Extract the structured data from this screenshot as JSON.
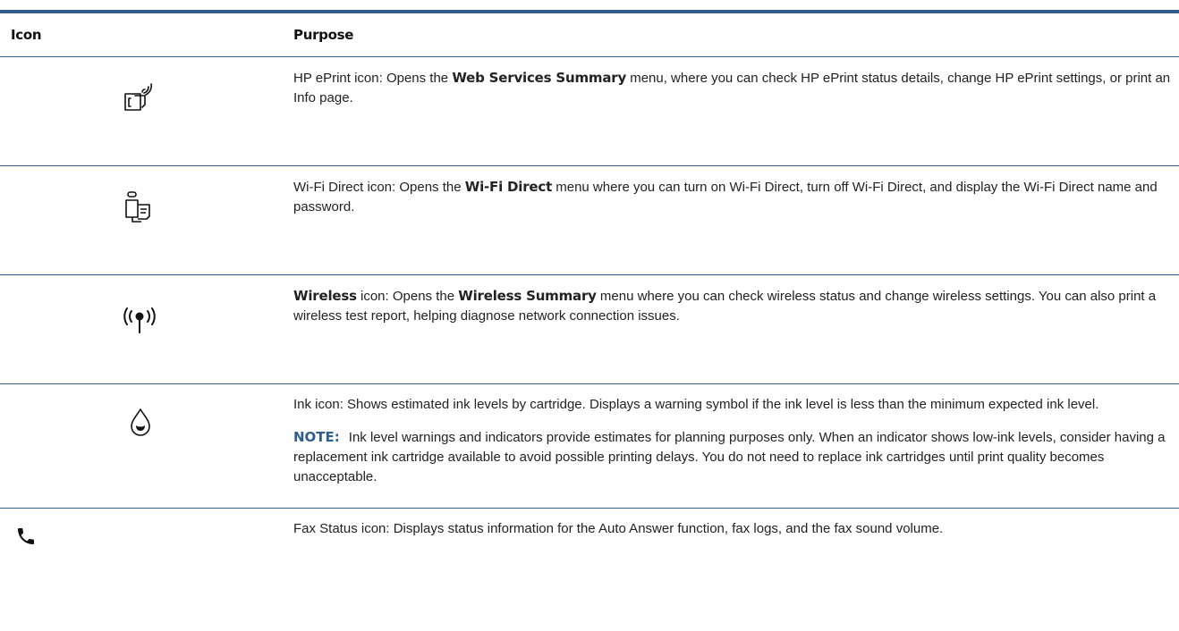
{
  "table": {
    "headers": {
      "icon": "Icon",
      "purpose": "Purpose"
    },
    "rows": [
      {
        "icon": "eprint-icon",
        "pre": "HP ePrint icon: Opens the ",
        "bold": "Web Services Summary",
        "post": " menu, where you can check HP ePrint status details, change HP ePrint settings, or print an Info page."
      },
      {
        "icon": "wifi-direct-icon",
        "pre": "Wi-Fi Direct icon: Opens the ",
        "bold": "Wi-Fi Direct",
        "post": " menu where you can turn on Wi-Fi Direct, turn off Wi-Fi Direct, and display the Wi-Fi Direct name and password."
      },
      {
        "icon": "wireless-icon",
        "lead_bold": "Wireless",
        "pre": " icon: Opens the ",
        "bold": "Wireless Summary",
        "post": " menu where you can check wireless status and change wireless settings. You can also print a wireless test report, helping diagnose network connection issues."
      },
      {
        "icon": "ink-drop-icon",
        "text": "Ink icon: Shows estimated ink levels by cartridge. Displays a warning symbol if the ink level is less than the minimum expected ink level.",
        "note_label": "NOTE:",
        "note_text": "Ink level warnings and indicators provide estimates for planning purposes only. When an indicator shows low-ink levels, consider having a replacement ink cartridge available to avoid possible printing delays. You do not need to replace ink cartridges until print quality becomes unacceptable."
      },
      {
        "icon": "fax-phone-icon",
        "text": "Fax Status icon: Displays status information for the Auto Answer function, fax logs, and the fax sound volume."
      }
    ]
  },
  "colors": {
    "rule": "#2f5f91",
    "note_label": "#2f5f91",
    "text": "#222222"
  }
}
